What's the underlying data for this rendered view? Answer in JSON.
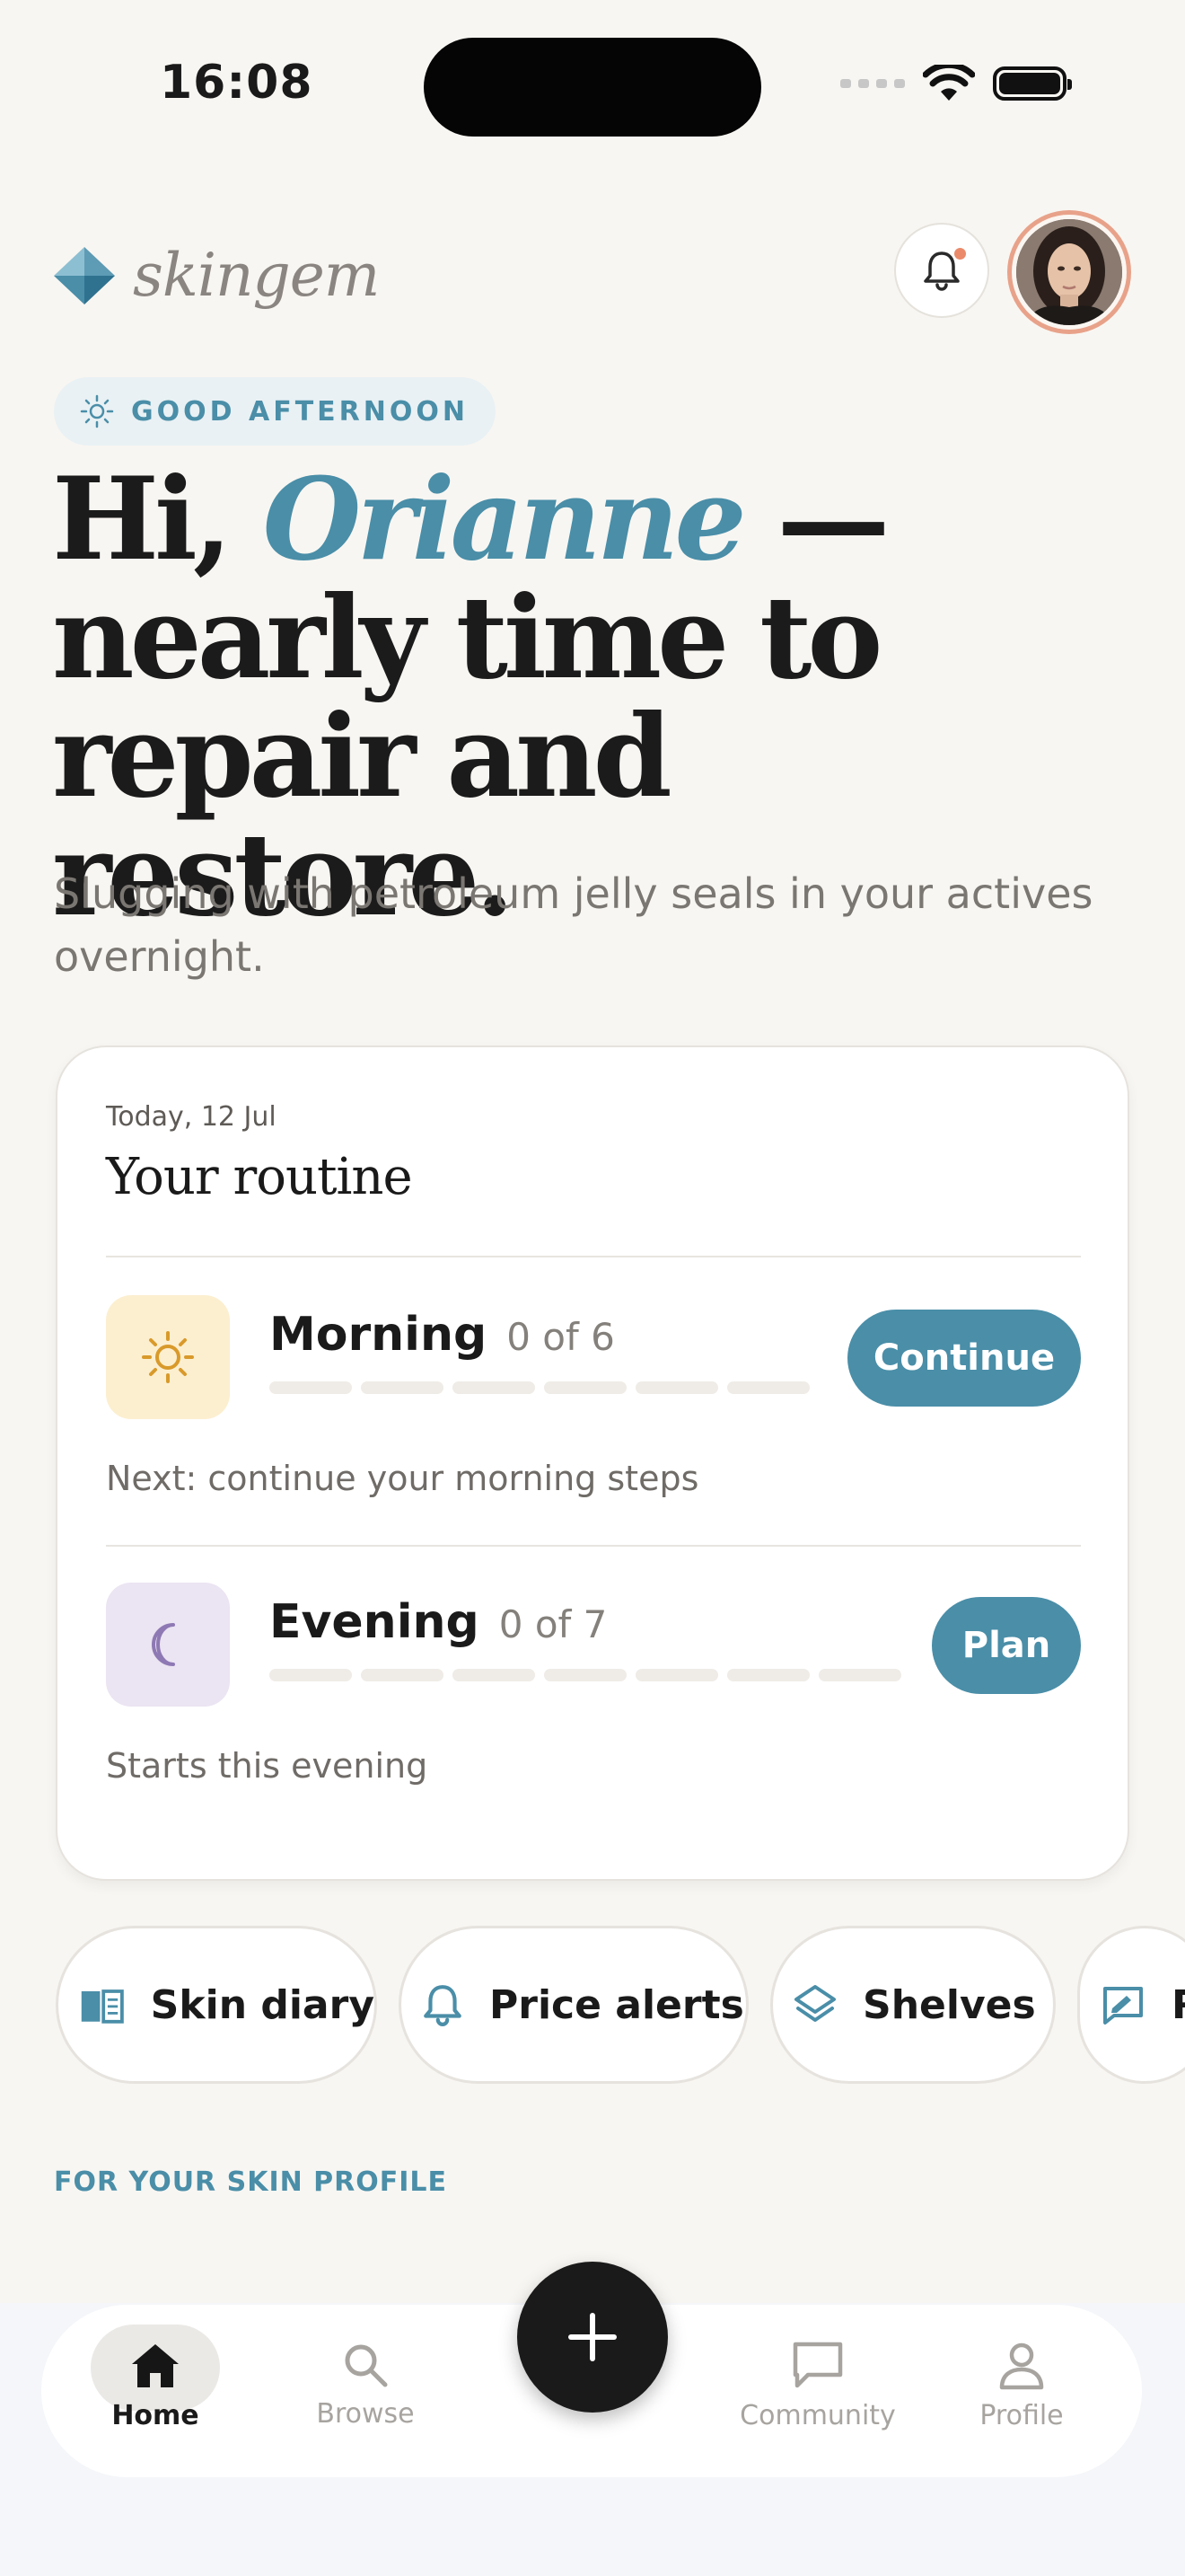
{
  "status_bar": {
    "time": "16:08"
  },
  "app": {
    "name": "skingem"
  },
  "header": {
    "greeting_badge": "GOOD AFTERNOON"
  },
  "headline": {
    "prefix": "Hi, ",
    "name": "Orianne",
    "suffix": " — nearly time to repair and restore."
  },
  "subtitle": "Slugging with petroleum jelly seals in your actives overnight.",
  "routine": {
    "date": "Today, 12 Jul",
    "title": "Your routine",
    "morning": {
      "name": "Morning",
      "progress_text": "0 of 6",
      "completed_steps": 0,
      "total_steps": 6,
      "button": "Continue",
      "note": "Next: continue your morning steps"
    },
    "evening": {
      "name": "Evening",
      "progress_text": "0 of 7",
      "completed_steps": 0,
      "total_steps": 7,
      "button": "Plan",
      "note": "Starts this evening"
    }
  },
  "quick_actions": [
    {
      "label": "Skin diary",
      "icon": "book-icon"
    },
    {
      "label": "Price alerts",
      "icon": "bell-icon"
    },
    {
      "label": "Shelves",
      "icon": "layers-icon"
    },
    {
      "label": "R",
      "icon": "review-icon"
    }
  ],
  "section_label": "FOR YOUR SKIN PROFILE",
  "tabs": [
    {
      "label": "Home",
      "icon": "home-icon",
      "active": true
    },
    {
      "label": "Browse",
      "icon": "search-icon",
      "active": false
    },
    {
      "label": "Community",
      "icon": "chat-icon",
      "active": false
    },
    {
      "label": "Profile",
      "icon": "person-icon",
      "active": false
    }
  ],
  "colors": {
    "accent": "#4a8ea8",
    "background": "#f8f6f2",
    "morning_icon_bg": "#fcefd0",
    "evening_icon_bg": "#ebe4f2",
    "notification_dot": "#ea8a6a"
  }
}
